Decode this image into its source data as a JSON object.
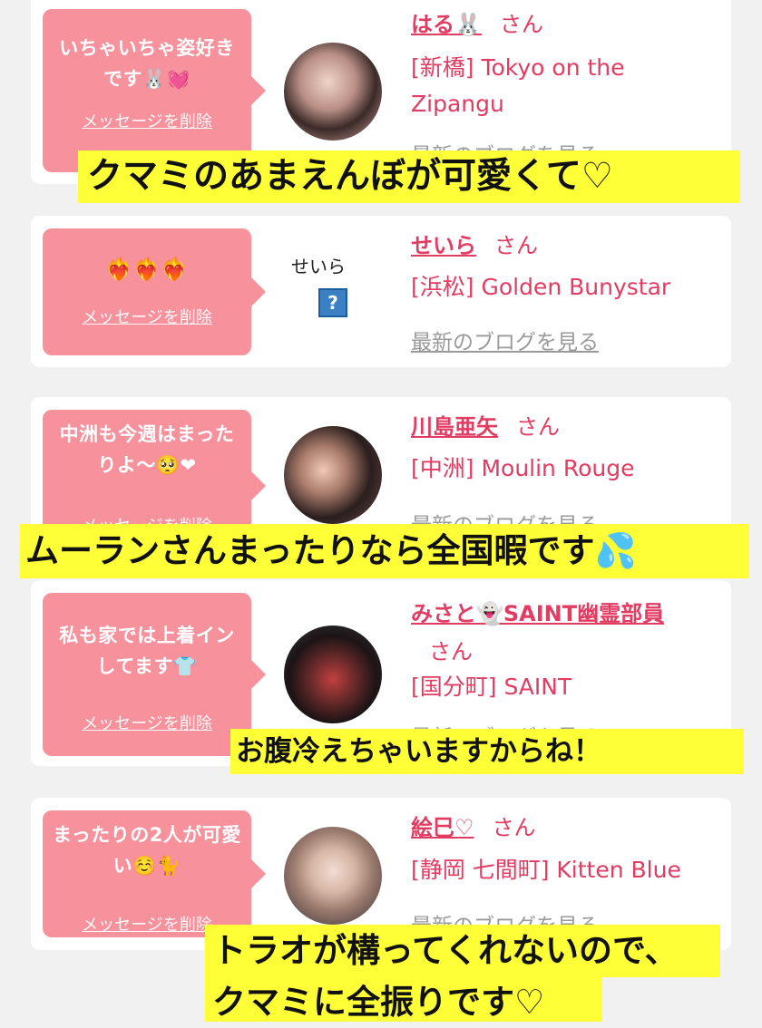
{
  "colors": {
    "accent": "#e23c63",
    "bubble": "#f7919c",
    "caption_bg": "#ffff38"
  },
  "cards": [
    {
      "message": "いちゃいちゃ姿好きです🐰💓",
      "delete_label": "メッセージを削除",
      "name": "はる🐰",
      "honorific": "さん",
      "shop": "[新橋] Tokyo on the Zipangu",
      "blog_link": "最新のブログを見る"
    },
    {
      "message": "❤️‍🔥❤️‍🔥❤️‍🔥",
      "delete_label": "メッセージを削除",
      "name": "せいら",
      "honorific": "さん",
      "shop": "[浜松] Golden Bunystar",
      "blog_link": "最新のブログを見る",
      "avatar_alt": "せいら"
    },
    {
      "message": "中洲も今週はまったりよ〜🥺❤",
      "delete_label": "メッセージを削除",
      "name": "川島亜矢",
      "honorific": "さん",
      "shop": "[中洲] Moulin Rouge",
      "blog_link": "最新のブログを見る"
    },
    {
      "message": "私も家では上着インしてます👕",
      "delete_label": "メッセージを削除",
      "name": "みさと👻SAINT幽霊部員",
      "honorific": "さん",
      "shop": "[国分町] SAINT",
      "blog_link": "最新のブログを見る"
    },
    {
      "message": "まったりの2人が可愛い☺️🐈",
      "delete_label": "メッセージを削除",
      "name": "絵巳♡",
      "honorific": "さん",
      "shop": "[静岡 七間町] Kitten Blue",
      "blog_link": "最新のブログを見る"
    }
  ],
  "captions": [
    "クマミのあまえんぼが可愛くて♡",
    "ムーランさんまったりなら全国暇です💦",
    "お腹冷えちゃいますからね！",
    "トラオが構ってくれないので、",
    "クマミに全振りです♡"
  ]
}
